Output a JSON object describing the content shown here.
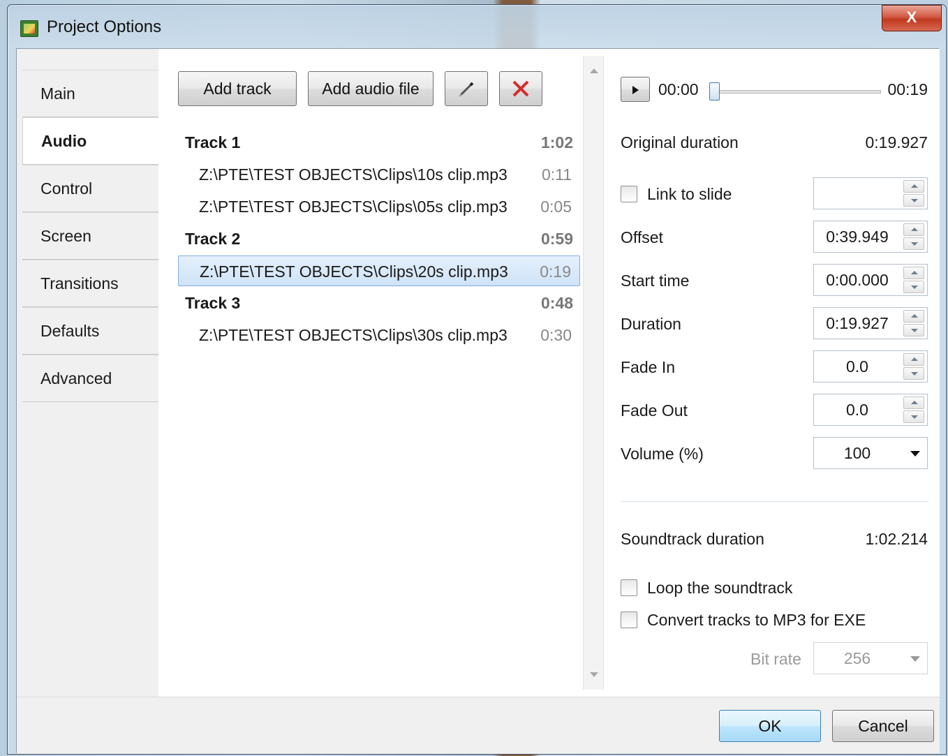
{
  "window": {
    "title": "Project Options",
    "close_label": "X"
  },
  "sidebar": {
    "tabs": [
      {
        "label": "Main"
      },
      {
        "label": "Audio",
        "active": true
      },
      {
        "label": "Control"
      },
      {
        "label": "Screen"
      },
      {
        "label": "Transitions"
      },
      {
        "label": "Defaults"
      },
      {
        "label": "Advanced"
      }
    ]
  },
  "toolbar": {
    "add_track": "Add track",
    "add_audio_file": "Add audio file",
    "edit_icon": "pencil-icon",
    "delete_icon": "red-x-icon",
    "delete_color": "#d62b2b"
  },
  "tracks": [
    {
      "name": "Track 1",
      "duration": "1:02",
      "clips": [
        {
          "path": "Z:\\PTE\\TEST OBJECTS\\Clips\\10s clip.mp3",
          "duration": "0:11"
        },
        {
          "path": "Z:\\PTE\\TEST OBJECTS\\Clips\\05s clip.mp3",
          "duration": "0:05"
        }
      ]
    },
    {
      "name": "Track 2",
      "duration": "0:59",
      "clips": [
        {
          "path": "Z:\\PTE\\TEST OBJECTS\\Clips\\20s clip.mp3",
          "duration": "0:19",
          "selected": true
        }
      ]
    },
    {
      "name": "Track 3",
      "duration": "0:48",
      "clips": [
        {
          "path": "Z:\\PTE\\TEST OBJECTS\\Clips\\30s clip.mp3",
          "duration": "0:30"
        }
      ]
    }
  ],
  "player": {
    "play_icon": "play-icon",
    "current": "00:00",
    "total": "00:19",
    "position": 0.0
  },
  "properties": {
    "original_duration_label": "Original duration",
    "original_duration_value": "0:19.927",
    "link_to_slide_label": "Link to slide",
    "link_to_slide_value": "",
    "offset_label": "Offset",
    "offset_value": "0:39.949",
    "start_time_label": "Start time",
    "start_time_value": "0:00.000",
    "duration_label": "Duration",
    "duration_value": "0:19.927",
    "fade_in_label": "Fade In",
    "fade_in_value": "0.0",
    "fade_out_label": "Fade Out",
    "fade_out_value": "0.0",
    "volume_label": "Volume (%)",
    "volume_value": "100"
  },
  "soundtrack": {
    "duration_label": "Soundtrack duration",
    "duration_value": "1:02.214",
    "loop_label": "Loop the soundtrack",
    "convert_label": "Convert tracks to MP3 for EXE",
    "bitrate_label": "Bit rate",
    "bitrate_value": "256"
  },
  "footer": {
    "ok": "OK",
    "cancel": "Cancel"
  }
}
